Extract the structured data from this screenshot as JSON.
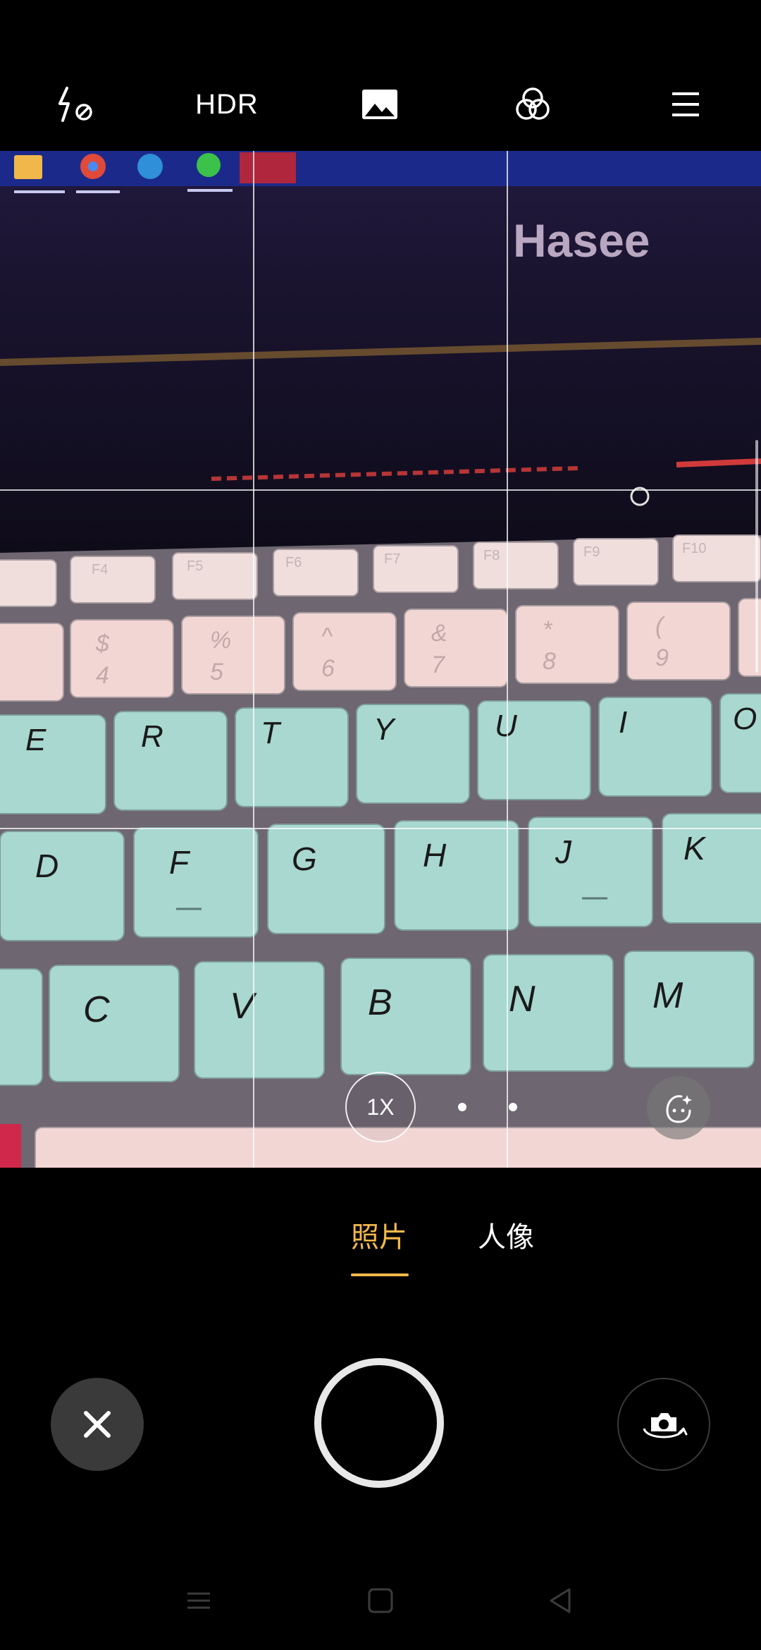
{
  "toolbar": {
    "flash_icon": "flash-off-icon",
    "hdr_label": "HDR",
    "gallery_icon": "image-icon",
    "filter_icon": "filter-circles-icon",
    "menu_icon": "menu-icon"
  },
  "viewfinder": {
    "zoom_label": "1X",
    "beauty_icon": "beauty-face-icon",
    "scene": {
      "brand_text": "Hasee",
      "fkeys": [
        "F4",
        "F5",
        "F6",
        "F7",
        "F8",
        "F9",
        "F10"
      ],
      "num_keys": [
        {
          "top": "$",
          "bottom": "4"
        },
        {
          "top": "%",
          "bottom": "5"
        },
        {
          "top": "^",
          "bottom": "6"
        },
        {
          "top": "&",
          "bottom": "7"
        },
        {
          "top": "*",
          "bottom": "8"
        },
        {
          "top": "(",
          "bottom": "9"
        }
      ],
      "row_qwerty": [
        "E",
        "R",
        "T",
        "Y",
        "U",
        "I",
        "O"
      ],
      "row_asdf": [
        "D",
        "F",
        "G",
        "H",
        "J",
        "K"
      ],
      "row_zxcv": [
        "C",
        "V",
        "B",
        "N",
        "M"
      ]
    }
  },
  "modes": {
    "photo": "照片",
    "portrait": "人像",
    "active": "photo"
  },
  "controls": {
    "close_icon": "close-icon",
    "shutter_icon": "shutter-button",
    "flip_icon": "camera-flip-icon"
  },
  "navbar": {
    "menu_icon": "nav-menu-icon",
    "home_icon": "nav-home-icon",
    "back_icon": "nav-back-icon"
  },
  "colors": {
    "accent": "#f2b84b",
    "key_teal": "#a8d8d0",
    "key_pink": "#f2d6d4"
  }
}
